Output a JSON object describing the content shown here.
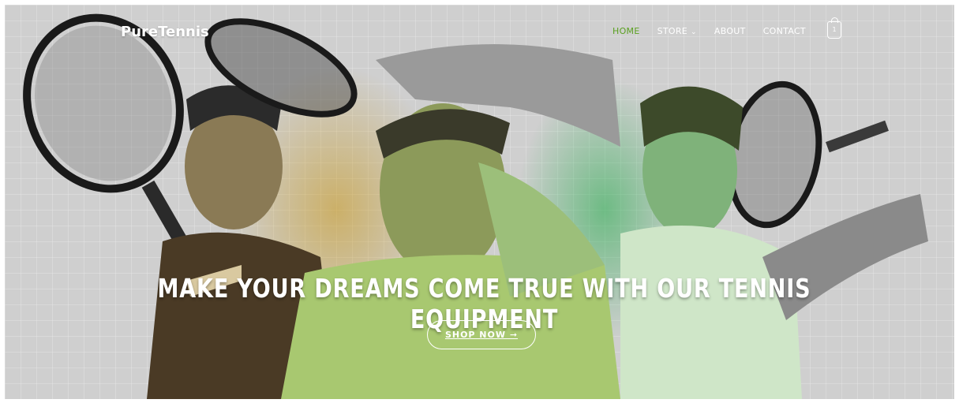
{
  "brand": {
    "name": "PureTennis"
  },
  "nav": {
    "items": [
      {
        "label": "HOME",
        "active": true
      },
      {
        "label": "STORE",
        "has_dropdown": true
      },
      {
        "label": "ABOUT"
      },
      {
        "label": "CONTACT"
      }
    ],
    "cart": {
      "icon": "shopping-bag-icon",
      "count": "1"
    }
  },
  "hero": {
    "headline": "MAKE YOUR DREAMS COME TRUE WITH OUR TENNIS EQUIPMENT",
    "cta_label": "SHOP NOW ➞",
    "colors": {
      "accent_active": "#5aa020",
      "text": "#ffffff",
      "gold_tint": "#c89614",
      "green_tint": "#1eaa46"
    }
  }
}
